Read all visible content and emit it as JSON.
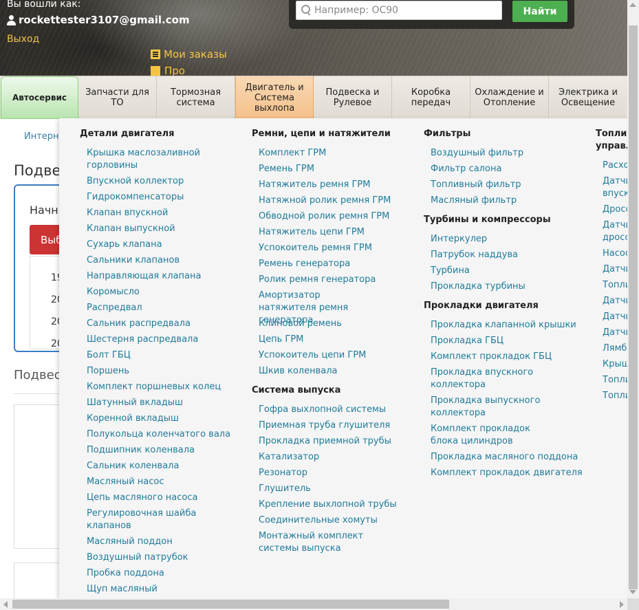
{
  "header": {
    "login_label": "Вы вошли как:",
    "user_email": "rockettester3107@gmail.com",
    "logout": "Выход",
    "orders": "Мои заказы",
    "orders2": "Проф"
  },
  "search": {
    "placeholder": "Например: OC90",
    "button": "Найти"
  },
  "nav": {
    "tabs": [
      {
        "label": "Автосервис"
      },
      {
        "label": "Запчасти для ТО"
      },
      {
        "label": "Тормозная система"
      },
      {
        "label": "Двигатель и Система выхлопа"
      },
      {
        "label": "Подвеска и Рулевое"
      },
      {
        "label": "Коробка передач"
      },
      {
        "label": "Охлаждение и Отопление"
      },
      {
        "label": "Электрика и Освещение"
      }
    ]
  },
  "page": {
    "breadcrumb": "Интерне",
    "title": "Подве",
    "card_label": "Начн",
    "select_button": "Выб",
    "years": [
      "19",
      "20",
      "20",
      "20"
    ],
    "sub_title": "Подвес"
  },
  "menu": {
    "col1": {
      "title": "Детали двигателя",
      "items": [
        "Крышка маслозаливной горловины",
        "Впускной коллектор",
        "Гидрокомпенсаторы",
        "Клапан впускной",
        "Клапан выпускной",
        "Сухарь клапана",
        "Сальники клапанов",
        "Направляющая клапана",
        "Коромысло",
        "Распредвал",
        "Сальник распредвала",
        "Шестерня распредвала",
        "Болт ГБЦ",
        "Поршень",
        "Комплект поршневых колец",
        "Шатунный вкладыш",
        "Коренной вкладыш",
        "Полукольца коленчатого вала",
        "Подшипник коленвала",
        "Сальник коленвала",
        "Масляный насос",
        "Цепь масляного насоса",
        "Регулировочная шайба клапанов",
        "Масляный поддон",
        "Воздушный патрубок",
        "Пробка поддона",
        "Щуп масляный"
      ]
    },
    "col2": {
      "title": "Ремни, цепи и натяжители",
      "items": [
        "Комплект ГРМ",
        "Ремень ГРМ",
        "Натяжитель ремня ГРМ",
        "Натяжной ролик ремня ГРМ",
        "Обводной ролик ремня ГРМ",
        "Натяжитель цепи ГРМ",
        "Успокоитель ремня ГРМ",
        "Ремень генератора",
        "Ролик ремня генератора",
        "Амортизатор натяжителя ремня генератора",
        "Клиновой ремень",
        "Цепь ГРМ",
        "Успокоитель цепи ГРМ",
        "Шкив коленвала"
      ],
      "title2": "Система выпуска",
      "items2": [
        "Гофра выхлопной системы",
        "Приемная труба глушителя",
        "Прокладка приемной трубы",
        "Катализатор",
        "Резонатор",
        "Глушитель",
        "Крепление выхлопной трубы",
        "Соединительные хомуты",
        "Монтажный комплект системы выпуска"
      ]
    },
    "col3": {
      "title": "Фильтры",
      "items": [
        "Воздушный фильтр",
        "Фильтр салона",
        "Топливный фильтр",
        "Масляный фильтр"
      ],
      "title2": "Турбины и компрессоры",
      "items2": [
        "Интеркулер",
        "Патрубок наддува",
        "Турбина",
        "Прокладка турбины"
      ],
      "title3": "Прокладки двигателя",
      "items3": [
        "Прокладка клапанной крышки",
        "Прокладка ГБЦ",
        "Комплект прокладок ГБЦ",
        "Прокладка впускного коллектора",
        "Прокладка выпускного коллектора",
        "Комплект прокладок блока цилиндров",
        "Прокладка масляного поддона",
        "Комплект прокладок двигателя"
      ]
    },
    "col4": {
      "title": "Топлив управл",
      "items": [
        "Расход",
        "Датчи впуска",
        "Дросс",
        "Датчи дроссе",
        "Насос",
        "Датчи",
        "Топли",
        "Датчи",
        "Датчи",
        "Датчи",
        "Лямбд",
        "Крыш",
        "Топли",
        "Топли"
      ]
    }
  }
}
